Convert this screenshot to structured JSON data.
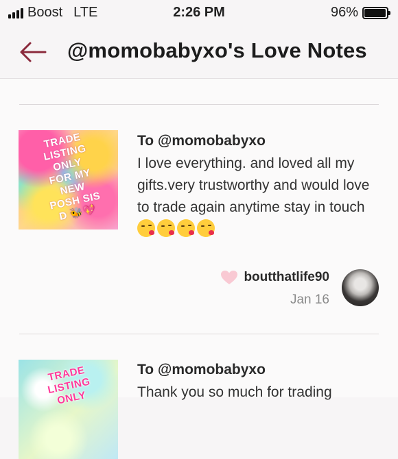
{
  "status_bar": {
    "carrier": "Boost",
    "network": "LTE",
    "time": "2:26 PM",
    "battery": "96%",
    "battery_level": 0.96
  },
  "header": {
    "title": "@momobabyxo's Love Notes",
    "back_icon": "back-arrow-icon",
    "accent_color": "#8b2a3c"
  },
  "notes": [
    {
      "thumbnail_text": "TRADE\nLISTING\nONLY\nFOR MY\nNEW\nPOSH SIS\nD 🐝💖",
      "to": "To @momobabyxo",
      "text": "I love everything. and loved all my gifts.very trustworthy and would love to trade again anytime stay in touch",
      "emoji": [
        "kiss-face",
        "kiss-face",
        "kiss-face",
        "kiss-face"
      ],
      "author": "boutthatlife90",
      "date": "Jan 16"
    },
    {
      "thumbnail_text": "TRADE\nLISTING\nONLY",
      "to": "To @momobabyxo",
      "text": "Thank you so much for trading"
    }
  ]
}
